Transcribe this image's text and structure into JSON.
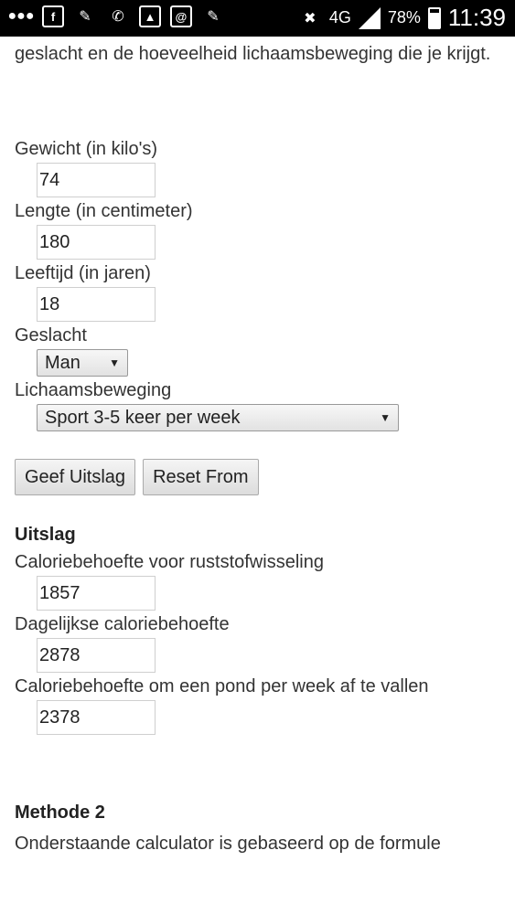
{
  "statusbar": {
    "network": "4G",
    "battery": "78%",
    "time": "11:39"
  },
  "intro_text": "geslacht en de hoeveelheid lichaamsbeweging die je krijgt.",
  "form": {
    "weight_label": "Gewicht (in kilo's)",
    "weight_value": "74",
    "height_label": "Lengte (in centimeter)",
    "height_value": "180",
    "age_label": "Leeftijd (in jaren)",
    "age_value": "18",
    "gender_label": "Geslacht",
    "gender_value": "Man",
    "activity_label": "Lichaamsbeweging",
    "activity_value": "Sport 3-5 keer per week"
  },
  "buttons": {
    "submit": "Geef Uitslag",
    "reset": "Reset From"
  },
  "result": {
    "heading": "Uitslag",
    "bmr_label": "Caloriebehoefte voor ruststofwisseling",
    "bmr_value": "1857",
    "daily_label": "Dagelijkse caloriebehoefte",
    "daily_value": "2878",
    "lose_label": "Caloriebehoefte om een pond per week af te vallen",
    "lose_value": "2378"
  },
  "method2": {
    "heading": "Methode 2",
    "text": "Onderstaande calculator is gebaseerd op de formule"
  }
}
